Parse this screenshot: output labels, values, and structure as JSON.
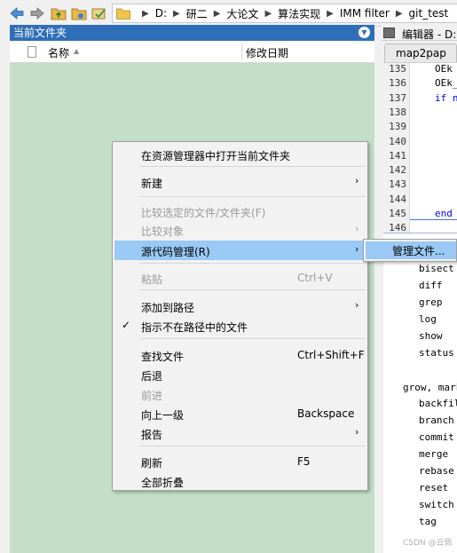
{
  "address_bar": {
    "path": [
      "D:",
      "研二",
      "大论文",
      "算法实现",
      "IMM filter",
      "git_test"
    ]
  },
  "current_folder": {
    "title": "当前文件夹",
    "columns": {
      "name": "名称",
      "modified": "修改日期"
    }
  },
  "editor": {
    "title": "编辑器 - D:",
    "tab": "map2pap",
    "lines": [
      {
        "n": "135",
        "text": "OEk"
      },
      {
        "n": "136",
        "text": "OEk_"
      },
      {
        "n": "137",
        "text": "if n"
      },
      {
        "n": "138",
        "text": ""
      },
      {
        "n": "139",
        "text": ""
      },
      {
        "n": "140",
        "text": ""
      },
      {
        "n": "141",
        "text": ""
      },
      {
        "n": "142",
        "text": ""
      },
      {
        "n": "143",
        "text": ""
      },
      {
        "n": "144",
        "text": ""
      },
      {
        "n": "145",
        "text": "end"
      },
      {
        "n": "146",
        "text": "%% -"
      }
    ]
  },
  "console": {
    "lines": [
      "bisect",
      "diff",
      "grep",
      "log",
      "show",
      "status",
      "",
      "grow, mark",
      "backfill",
      "branch",
      "commit",
      "merge",
      "rebase",
      "reset",
      "switch",
      "tag"
    ]
  },
  "context_menu": {
    "items": [
      {
        "label": "在资源管理器中打开当前文件夹",
        "shortcut": "",
        "submenu": false,
        "disabled": false
      },
      {
        "label": "新建",
        "shortcut": "",
        "submenu": true,
        "disabled": false
      },
      {
        "label": "比较选定的文件/文件夹(F)",
        "shortcut": "",
        "submenu": false,
        "disabled": true
      },
      {
        "label": "比较对象",
        "shortcut": "",
        "submenu": true,
        "disabled": true
      },
      {
        "label": "源代码管理(R)",
        "shortcut": "",
        "submenu": true,
        "disabled": false,
        "highlighted": true
      },
      {
        "label": "粘贴",
        "shortcut": "Ctrl+V",
        "submenu": false,
        "disabled": true
      },
      {
        "label": "添加到路径",
        "shortcut": "",
        "submenu": true,
        "disabled": false
      },
      {
        "label": "指示不在路径中的文件",
        "shortcut": "",
        "submenu": false,
        "disabled": false,
        "checked": true
      },
      {
        "label": "查找文件",
        "shortcut": "Ctrl+Shift+F",
        "submenu": false,
        "disabled": false
      },
      {
        "label": "后退",
        "shortcut": "",
        "submenu": false,
        "disabled": false
      },
      {
        "label": "前进",
        "shortcut": "",
        "submenu": false,
        "disabled": true
      },
      {
        "label": "向上一级",
        "shortcut": "Backspace",
        "submenu": false,
        "disabled": false
      },
      {
        "label": "报告",
        "shortcut": "",
        "submenu": true,
        "disabled": false
      },
      {
        "label": "刷新",
        "shortcut": "F5",
        "submenu": false,
        "disabled": false
      },
      {
        "label": "全部折叠",
        "shortcut": "",
        "submenu": false,
        "disabled": false
      }
    ],
    "check_glyph": "✓",
    "submenu_glyph": "›"
  },
  "source_control_submenu": {
    "items": [
      "管理文件..."
    ]
  },
  "watermark": "CSDN @云佩",
  "colors": {
    "panel_title_bg": "#2f6fb7",
    "file_area_bg": "#c3dfc6",
    "highlight": "#99c9f4"
  }
}
